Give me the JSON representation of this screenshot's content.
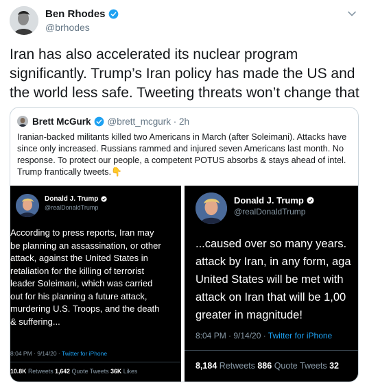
{
  "tweet": {
    "author_name": "Ben Rhodes",
    "author_handle": "@brhodes",
    "text": "Iran has also accelerated its nuclear program significantly. Trump’s Iran policy has made the US and the world less safe. Tweeting threats won’t change that"
  },
  "quoted": {
    "author_name": "Brett McGurk",
    "author_handle": "@brett_mcgurk · 2h",
    "text": "Iranian-backed militants killed two Americans in March (after Soleimani). Attacks have since only increased. Russians rammed and injured seven Americans last month. No response. To protect our people, a competent POTUS absorbs & stays ahead of intel. Trump frantically tweets.",
    "emoji": "👇"
  },
  "screenshot_left": {
    "name": "Donald J. Trump",
    "handle": "@realDonaldTrump",
    "lines": [
      "According to press reports, Iran may",
      "be planning an assassination, or other",
      "attack, against the United States in",
      "retaliation for the killing of terrorist",
      "leader Soleimani, which was carried",
      "out for his planning a future attack,",
      "murdering U.S. Troops, and the death",
      "& suffering..."
    ],
    "time": "8:04 PM · 9/14/20 · ",
    "source": "Twitter for iPhone",
    "retweets": "10.8K",
    "retweets_label": "Retweets",
    "quotes": "1,642",
    "quotes_label": "Quote Tweets",
    "likes": "36K",
    "likes_label": "Likes"
  },
  "screenshot_right": {
    "name": "Donald J. Trump",
    "handle": "@realDonaldTrump",
    "lines": [
      "...caused over so many years.",
      "attack by Iran, in any form, aga",
      "United States will be met with",
      "attack on Iran that will be 1,00",
      "greater in magnitude!"
    ],
    "time": "8:04 PM · 9/14/20 · ",
    "source": "Twitter for iPhone",
    "retweets": "8,184",
    "retweets_label": "Retweets",
    "quotes": "886",
    "quotes_label": "Quote Tweets",
    "likes": "32"
  },
  "colors": {
    "verified": "#1da1f2",
    "secondary_text": "#657786",
    "panel_bg": "#000000",
    "link": "#1da1f2"
  }
}
